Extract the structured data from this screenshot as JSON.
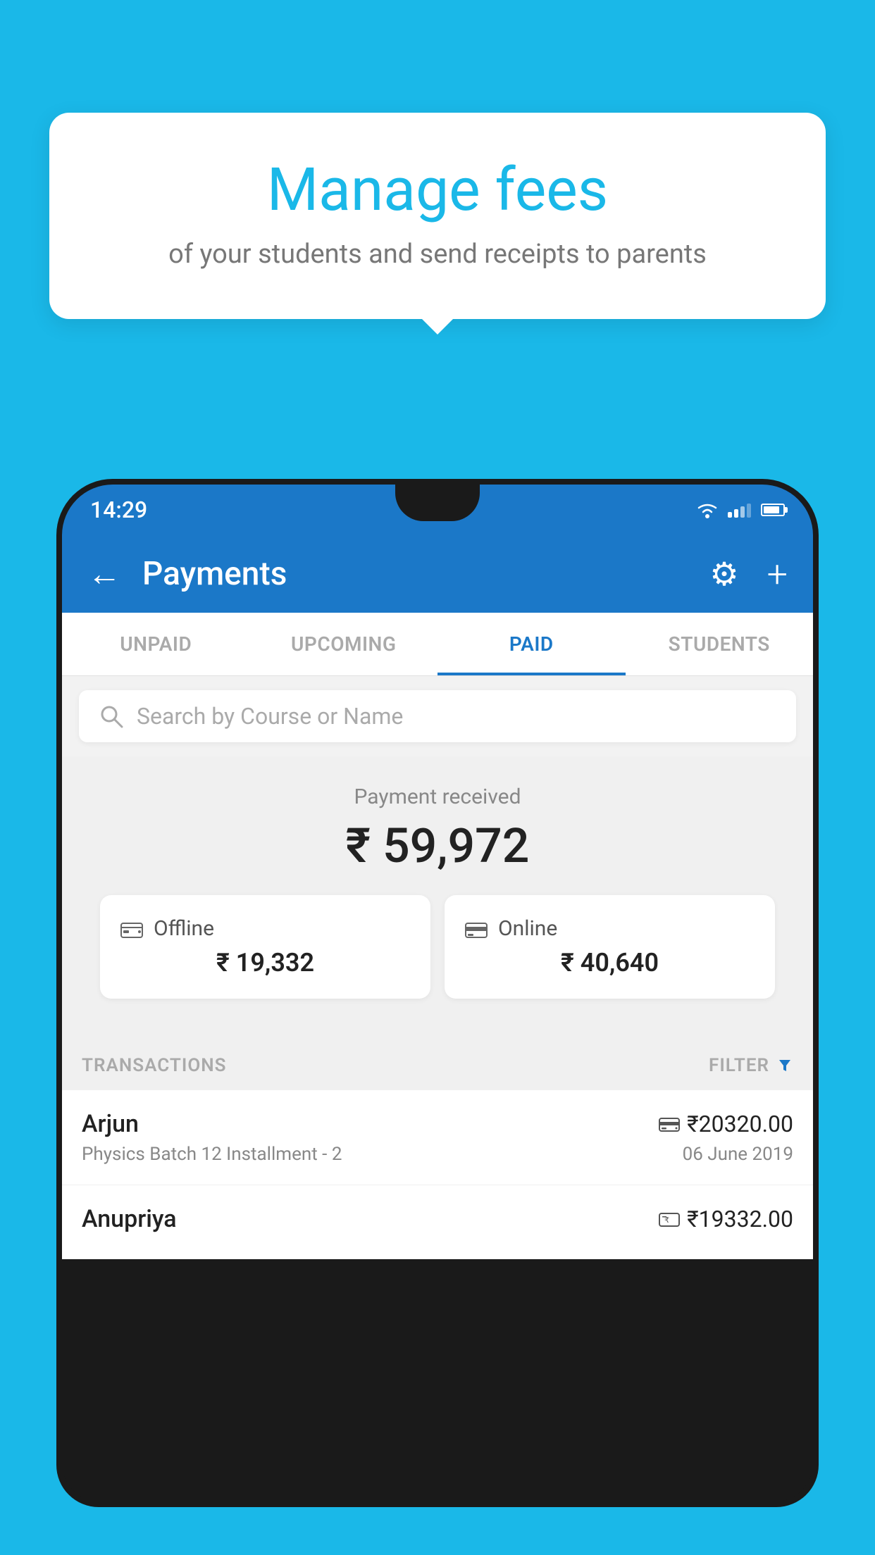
{
  "background_color": "#1ab8e8",
  "speech_bubble": {
    "title": "Manage fees",
    "subtitle": "of your students and send receipts to parents"
  },
  "status_bar": {
    "time": "14:29",
    "icons": [
      "wifi",
      "signal",
      "battery"
    ]
  },
  "app_bar": {
    "title": "Payments",
    "back_label": "←",
    "gear_label": "⚙",
    "plus_label": "+"
  },
  "tabs": [
    {
      "label": "UNPAID",
      "active": false
    },
    {
      "label": "UPCOMING",
      "active": false
    },
    {
      "label": "PAID",
      "active": true
    },
    {
      "label": "STUDENTS",
      "active": false
    }
  ],
  "search": {
    "placeholder": "Search by Course or Name"
  },
  "payment_summary": {
    "label": "Payment received",
    "amount": "₹ 59,972",
    "offline": {
      "label": "Offline",
      "amount": "₹ 19,332"
    },
    "online": {
      "label": "Online",
      "amount": "₹ 40,640"
    }
  },
  "transactions_section": {
    "label": "TRANSACTIONS",
    "filter_label": "FILTER"
  },
  "transactions": [
    {
      "name": "Arjun",
      "amount": "₹20320.00",
      "description": "Physics Batch 12 Installment - 2",
      "date": "06 June 2019",
      "payment_type": "card"
    },
    {
      "name": "Anupriya",
      "amount": "₹19332.00",
      "description": "",
      "date": "",
      "payment_type": "cash"
    }
  ]
}
